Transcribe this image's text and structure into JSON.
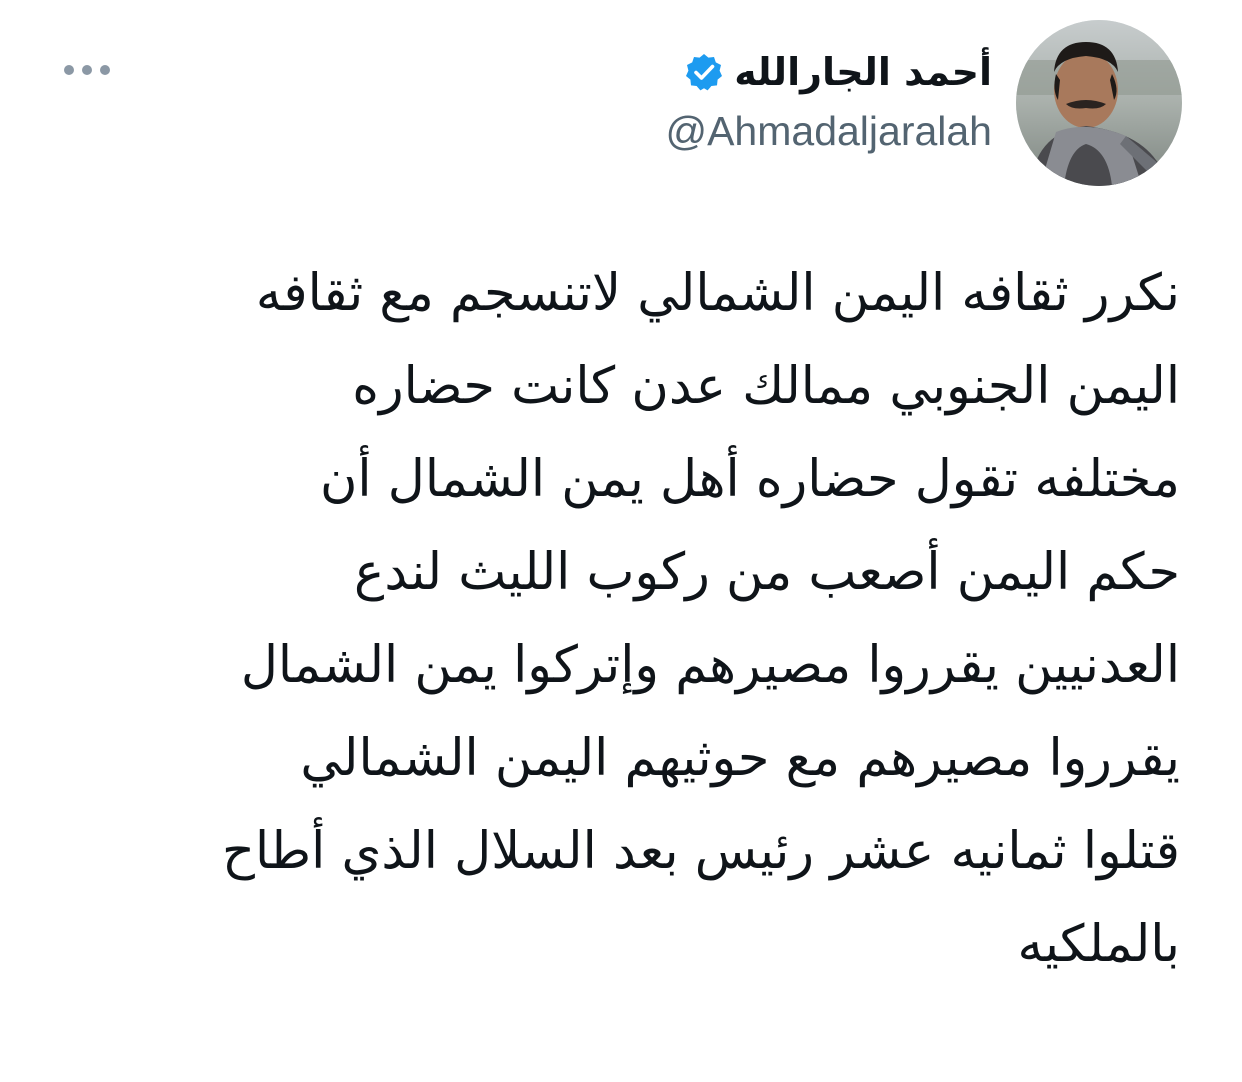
{
  "tweet": {
    "author": {
      "display_name": "أحمد الجارالله",
      "handle": "@Ahmadaljaralah",
      "verified": true,
      "avatar_icon": "profile-photo-avatar"
    },
    "more_icon": "more-options-icon",
    "body_lines": [
      "نكرر ثقافه اليمن الشمالي لاتنسجم مع ثقافه",
      "اليمن الجنوبي ممالك عدن كانت حضاره",
      "مختلفه تقول حضاره أهل يمن الشمال أن",
      "حكم اليمن أصعب من ركوب الليث لندع",
      "العدنيين يقرروا مصيرهم وإتركوا يمن الشمال",
      "يقرروا مصيرهم مع حوثيهم اليمن الشمالي",
      "قتلوا ثمانيه عشر رئيس بعد السلال الذي أطاح",
      "بالملكيه"
    ]
  },
  "colors": {
    "text": "#0f1419",
    "secondary": "#536471",
    "verified_blue": "#1d9bf0",
    "background": "#ffffff"
  }
}
